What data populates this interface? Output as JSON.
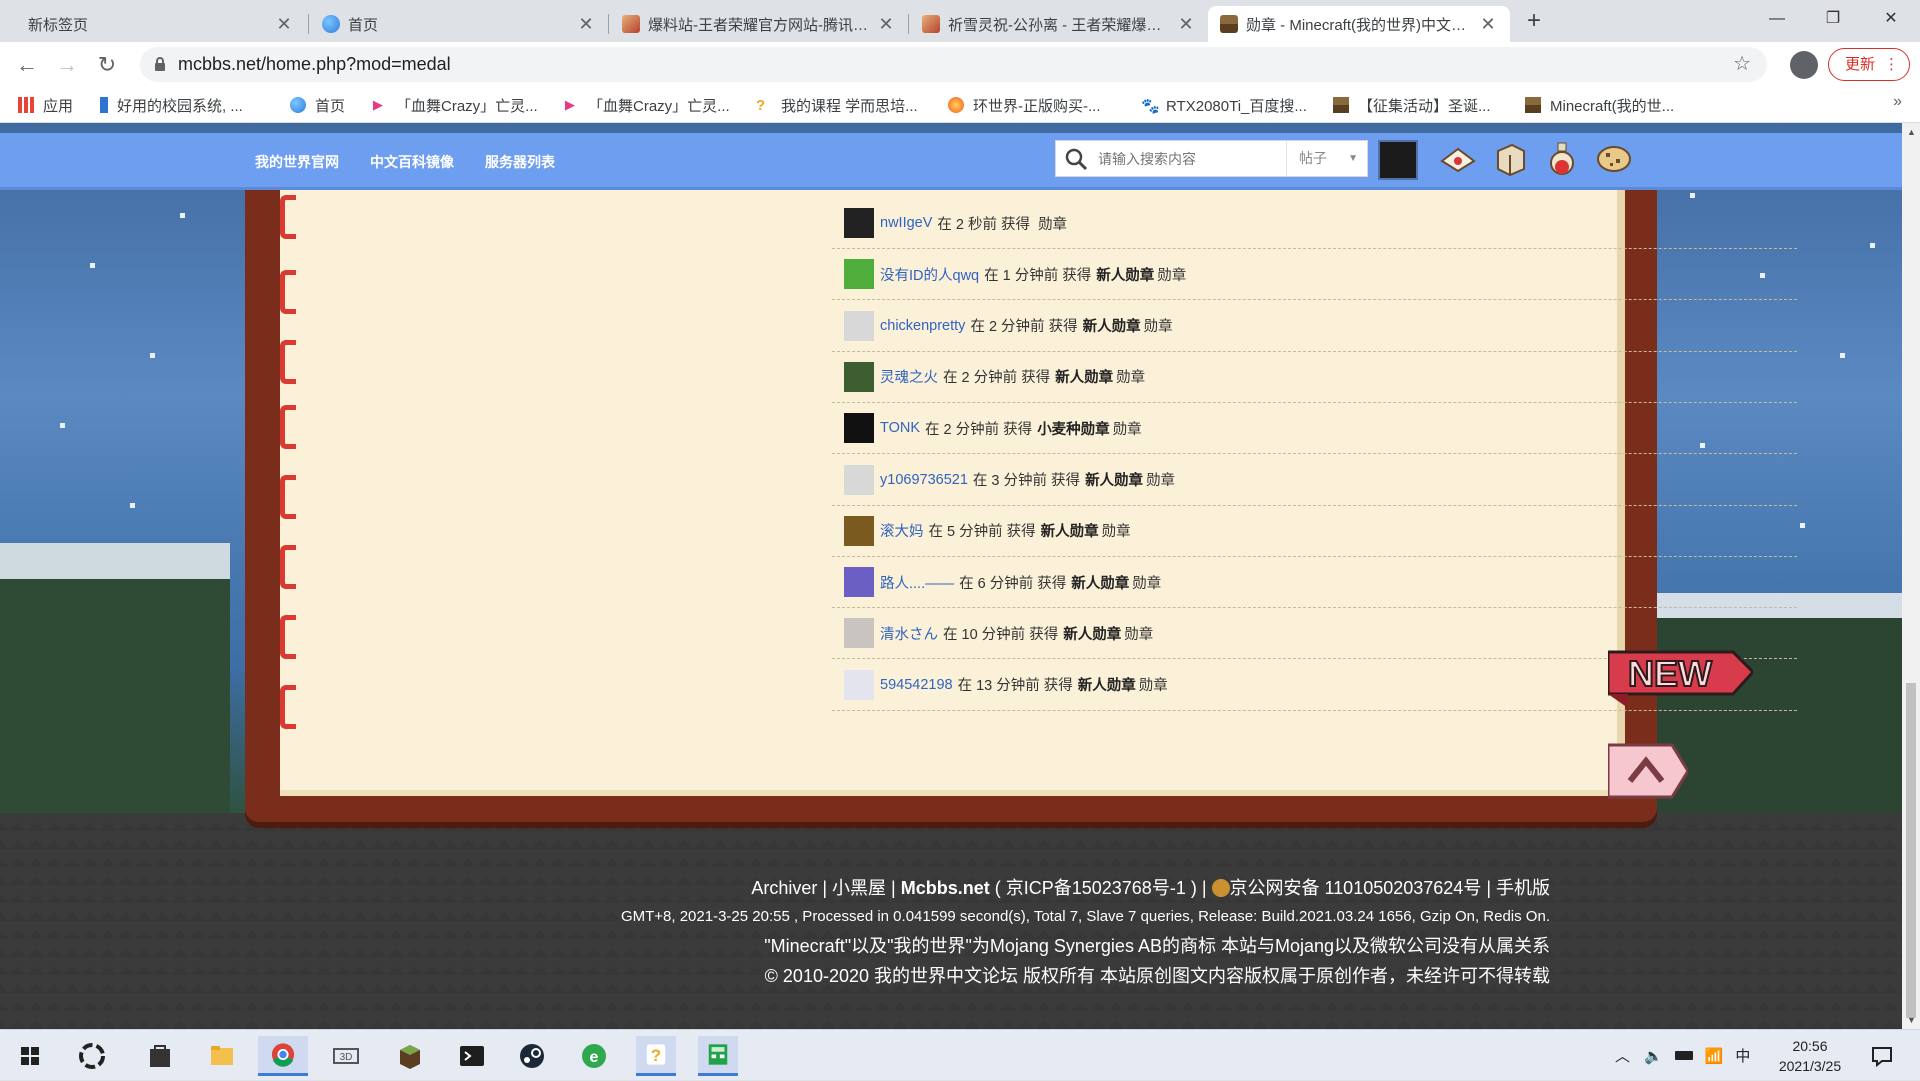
{
  "browser": {
    "tabs": [
      {
        "title": "新标签页",
        "icon": "new-tab-icon",
        "color": "#dee1e6"
      },
      {
        "title": "首页",
        "icon": "edge-globe-icon",
        "color": "#3f8be8"
      },
      {
        "title": "爆料站-王者荣耀官方网站-腾讯游戏",
        "icon": "honor-of-kings-icon",
        "color": "#b6412e"
      },
      {
        "title": "祈雪灵祝-公孙离 - 王者荣耀爆料站",
        "icon": "honor-of-kings-icon",
        "color": "#b6412e"
      },
      {
        "title": "勋章 - Minecraft(我的世界)中文论坛",
        "icon": "minecraft-block-icon",
        "color": "#6b4a2a",
        "active": true
      }
    ],
    "address": "mcbbs.net/home.php?mod=medal",
    "update_label": "更新",
    "bookmarks": [
      {
        "label": "应用",
        "icon": "apps-grid-icon",
        "color": "#e84335"
      },
      {
        "label": "好用的校园系统, ...",
        "icon": "bookmark-blue-icon",
        "color": "#2f74d0"
      },
      {
        "label": "首页",
        "icon": "edge-globe-icon",
        "color": "#3f8be8"
      },
      {
        "label": "「血舞Crazy」亡灵...",
        "icon": "bilibili-play-icon",
        "color": "#e53a86"
      },
      {
        "label": "「血舞Crazy」亡灵...",
        "icon": "bilibili-play-icon",
        "color": "#e53a86"
      },
      {
        "label": "我的课程 学而思培...",
        "icon": "xueersi-icon",
        "color": "#f0a81d"
      },
      {
        "label": "环世界-正版购买-...",
        "icon": "fire-icon",
        "color": "#f25a1d"
      },
      {
        "label": "RTX2080Ti_百度搜...",
        "icon": "baidu-paw-icon",
        "color": "#3245df"
      },
      {
        "label": "【征集活动】圣诞...",
        "icon": "minecraft-block-icon",
        "color": "#6b4a2a"
      },
      {
        "label": "Minecraft(我的世...",
        "icon": "minecraft-block-icon",
        "color": "#6b4a2a"
      }
    ]
  },
  "site": {
    "nav": [
      "我的世界官网",
      "中文百科镜像",
      "服务器列表"
    ],
    "search_placeholder": "请输入搜索内容",
    "search_scope": "帖子"
  },
  "medal_feed": [
    {
      "user": "nwIIgeV",
      "time": "在 2 秒前 获得",
      "medal": "",
      "suffix": "勋章",
      "avatar_color": "#222222"
    },
    {
      "user": "没有ID的人qwq",
      "time": "在 1 分钟前 获得",
      "medal": "新人勋章",
      "suffix": "勋章",
      "avatar_color": "#4fae3b"
    },
    {
      "user": "chickenpretty",
      "time": "在 2 分钟前 获得",
      "medal": "新人勋章",
      "suffix": "勋章",
      "avatar_color": "#d8d8d8"
    },
    {
      "user": "灵魂之火",
      "time": "在 2 分钟前 获得",
      "medal": "新人勋章",
      "suffix": "勋章",
      "avatar_color": "#3d5e2e"
    },
    {
      "user": "TONK",
      "time": "在 2 分钟前 获得",
      "medal": "小麦种勋章",
      "suffix": "勋章",
      "avatar_color": "#111111"
    },
    {
      "user": "y1069736521",
      "time": "在 3 分钟前 获得",
      "medal": "新人勋章",
      "suffix": "勋章",
      "avatar_color": "#d8d8d8"
    },
    {
      "user": "滚大妈",
      "time": "在 5 分钟前 获得",
      "medal": "新人勋章",
      "suffix": "勋章",
      "avatar_color": "#7a5a1e"
    },
    {
      "user": "路人....——",
      "time": "在 6 分钟前 获得",
      "medal": "新人勋章",
      "suffix": "勋章",
      "avatar_color": "#6b5fc4"
    },
    {
      "user": "清水さん",
      "time": "在 10 分钟前 获得",
      "medal": "新人勋章",
      "suffix": "勋章",
      "avatar_color": "#c9c4c0"
    },
    {
      "user": "594542198",
      "time": "在 13 分钟前 获得",
      "medal": "新人勋章",
      "suffix": "勋章",
      "avatar_color": "#e4e4ee"
    }
  ],
  "footer": {
    "line1_prefix": "Archiver | 小黑屋 | ",
    "line1_site": "Mcbbs.net",
    "line1_rest": " ( 京ICP备15023768号-1 ) | ",
    "line1_police": "京公网安备 11010502037624号 | 手机版",
    "line2": "GMT+8, 2021-3-25 20:55 , Processed in 0.041599 second(s), Total 7, Slave 7 queries, Release: Build.2021.03.24 1656, Gzip On, Redis On.",
    "line3": "\"Minecraft\"以及\"我的世界\"为Mojang Synergies AB的商标 本站与Mojang以及微软公司没有从属关系",
    "line4": "© 2010-2020 我的世界中文论坛 版权所有 本站原创图文内容版权属于原创作者，未经许可不得转载"
  },
  "ribbon_new": "NEW",
  "taskbar": {
    "apps": [
      "start-icon",
      "search-swirl-icon",
      "store-icon",
      "file-explorer-icon",
      "chrome-icon",
      "3d-viewer-icon",
      "minecraft-icon",
      "terminal-icon",
      "steam-icon",
      "edge-legacy-icon",
      "xueersi-icon",
      "calculator-icon"
    ],
    "ime": "中",
    "time": "20:56",
    "date": "2021/3/25"
  }
}
